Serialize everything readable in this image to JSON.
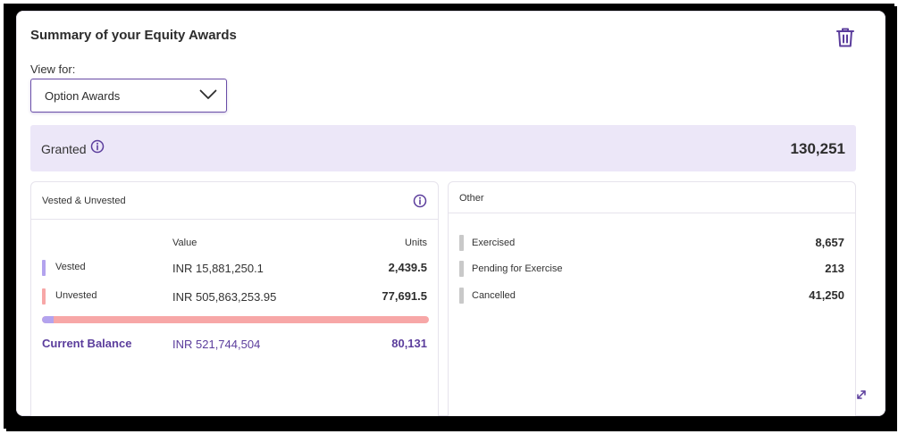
{
  "card": {
    "title": "Summary of your Equity Awards",
    "delete_icon": "trash-icon"
  },
  "view_for": {
    "label": "View for:",
    "selected": "Option Awards",
    "dropdown_icon": "chevron-down-icon"
  },
  "granted": {
    "label": "Granted",
    "info_icon": "info-icon",
    "value": "130,251"
  },
  "vested_unvested": {
    "title": "Vested & Unvested",
    "info_icon": "info-icon",
    "columns": {
      "value": "Value",
      "units": "Units"
    },
    "rows": [
      {
        "label": "Vested",
        "value": "INR 15,881,250.1",
        "units": "2,439.5",
        "color": "#b3a3ee"
      },
      {
        "label": "Unvested",
        "value": "INR 505,863,253.95",
        "units": "77,691.5",
        "color": "#f7a7a7"
      }
    ],
    "vested_fraction": 0.0305,
    "balance": {
      "label": "Current Balance",
      "value": "INR 521,744,504",
      "units": "80,131"
    }
  },
  "other": {
    "title": "Other",
    "rows": [
      {
        "label": "Exercised",
        "value": "8,657"
      },
      {
        "label": "Pending for Exercise",
        "value": "213"
      },
      {
        "label": "Cancelled",
        "value": "41,250"
      }
    ]
  },
  "expand_icon": "expand-icon",
  "colors": {
    "accent": "#5b3d9c",
    "granted_bg": "#ece7f8",
    "vested": "#b3a3ee",
    "unvested": "#f7a7a7",
    "other_bar": "#c9c9c9"
  }
}
